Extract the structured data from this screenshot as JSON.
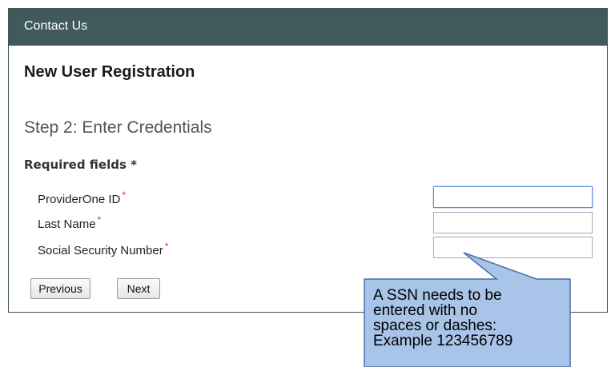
{
  "header": {
    "title": "Contact Us"
  },
  "page": {
    "title": "New User Registration",
    "step_title": "Step 2: Enter Credentials",
    "required_note": "Required fields *"
  },
  "form": {
    "required_marker": "*",
    "fields": [
      {
        "label": "ProviderOne ID",
        "value": ""
      },
      {
        "label": "Last Name",
        "value": ""
      },
      {
        "label": "Social Security Number",
        "value": ""
      }
    ]
  },
  "buttons": {
    "previous": "Previous",
    "next": "Next"
  },
  "callout": {
    "lines": [
      "A SSN needs to be",
      "entered with no",
      "spaces or dashes:",
      "Example 123456789"
    ],
    "fill_color": "#a8c4e8",
    "border_color": "#4a6fa5"
  }
}
